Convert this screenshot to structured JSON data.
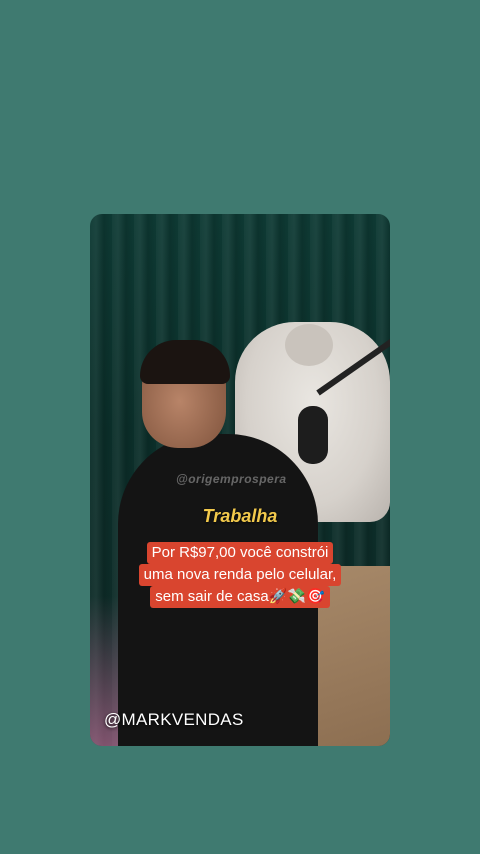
{
  "video": {
    "watermark": "@origemprospera",
    "caption_word": "Trabalha",
    "offer_lines": [
      "Por R$97,00 você constrói",
      "uma nova renda pelo celular,",
      "sem sair de casa🚀💸🎯"
    ],
    "handle": "@MARKVENDAS"
  },
  "colors": {
    "background": "#3f7a70",
    "caption_word": "#f2c94c",
    "offer_box": "#d9452f"
  }
}
